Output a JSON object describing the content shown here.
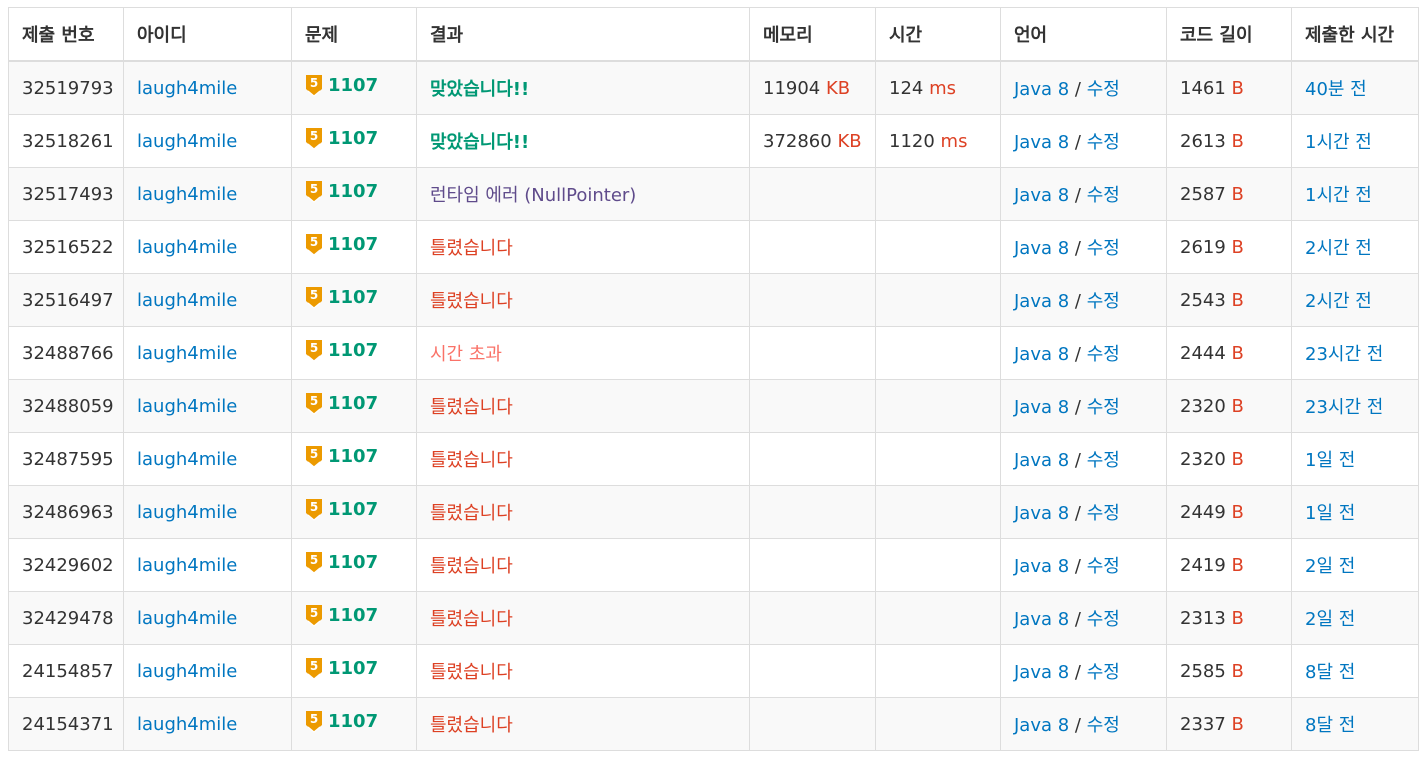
{
  "headers": [
    "제출 번호",
    "아이디",
    "문제",
    "결과",
    "메모리",
    "시간",
    "언어",
    "코드 길이",
    "제출한 시간"
  ],
  "colors": {
    "link": "#0076c0",
    "accepted": "#009874",
    "wrong": "#dd4124",
    "runtime_error": "#5f4b8b",
    "time_limit": "#fa7268",
    "tier_gold": "#ec9a00"
  },
  "tier_icon": "gold-5-tier-icon",
  "tier_label": "5",
  "rows": [
    {
      "id": "32519793",
      "user": "laugh4mile",
      "problem": "1107",
      "result": "맞았습니다!!",
      "status": "ac",
      "memory": "11904",
      "memory_unit": "KB",
      "time": "124",
      "time_unit": "ms",
      "lang": "Java 8",
      "sep": " / ",
      "edit": "수정",
      "length": "1461",
      "length_unit": "B",
      "submitted": "40분 전"
    },
    {
      "id": "32518261",
      "user": "laugh4mile",
      "problem": "1107",
      "result": "맞았습니다!!",
      "status": "ac",
      "memory": "372860",
      "memory_unit": "KB",
      "time": "1120",
      "time_unit": "ms",
      "lang": "Java 8",
      "sep": " / ",
      "edit": "수정",
      "length": "2613",
      "length_unit": "B",
      "submitted": "1시간 전"
    },
    {
      "id": "32517493",
      "user": "laugh4mile",
      "problem": "1107",
      "result": "런타임 에러 (NullPointer)",
      "status": "rte",
      "memory": "",
      "memory_unit": "",
      "time": "",
      "time_unit": "",
      "lang": "Java 8",
      "sep": " / ",
      "edit": "수정",
      "length": "2587",
      "length_unit": "B",
      "submitted": "1시간 전"
    },
    {
      "id": "32516522",
      "user": "laugh4mile",
      "problem": "1107",
      "result": "틀렸습니다",
      "status": "wa",
      "memory": "",
      "memory_unit": "",
      "time": "",
      "time_unit": "",
      "lang": "Java 8",
      "sep": " / ",
      "edit": "수정",
      "length": "2619",
      "length_unit": "B",
      "submitted": "2시간 전"
    },
    {
      "id": "32516497",
      "user": "laugh4mile",
      "problem": "1107",
      "result": "틀렸습니다",
      "status": "wa",
      "memory": "",
      "memory_unit": "",
      "time": "",
      "time_unit": "",
      "lang": "Java 8",
      "sep": " / ",
      "edit": "수정",
      "length": "2543",
      "length_unit": "B",
      "submitted": "2시간 전"
    },
    {
      "id": "32488766",
      "user": "laugh4mile",
      "problem": "1107",
      "result": "시간 초과",
      "status": "tle",
      "memory": "",
      "memory_unit": "",
      "time": "",
      "time_unit": "",
      "lang": "Java 8",
      "sep": " / ",
      "edit": "수정",
      "length": "2444",
      "length_unit": "B",
      "submitted": "23시간 전"
    },
    {
      "id": "32488059",
      "user": "laugh4mile",
      "problem": "1107",
      "result": "틀렸습니다",
      "status": "wa",
      "memory": "",
      "memory_unit": "",
      "time": "",
      "time_unit": "",
      "lang": "Java 8",
      "sep": " / ",
      "edit": "수정",
      "length": "2320",
      "length_unit": "B",
      "submitted": "23시간 전"
    },
    {
      "id": "32487595",
      "user": "laugh4mile",
      "problem": "1107",
      "result": "틀렸습니다",
      "status": "wa",
      "memory": "",
      "memory_unit": "",
      "time": "",
      "time_unit": "",
      "lang": "Java 8",
      "sep": " / ",
      "edit": "수정",
      "length": "2320",
      "length_unit": "B",
      "submitted": "1일 전"
    },
    {
      "id": "32486963",
      "user": "laugh4mile",
      "problem": "1107",
      "result": "틀렸습니다",
      "status": "wa",
      "memory": "",
      "memory_unit": "",
      "time": "",
      "time_unit": "",
      "lang": "Java 8",
      "sep": " / ",
      "edit": "수정",
      "length": "2449",
      "length_unit": "B",
      "submitted": "1일 전"
    },
    {
      "id": "32429602",
      "user": "laugh4mile",
      "problem": "1107",
      "result": "틀렸습니다",
      "status": "wa",
      "memory": "",
      "memory_unit": "",
      "time": "",
      "time_unit": "",
      "lang": "Java 8",
      "sep": " / ",
      "edit": "수정",
      "length": "2419",
      "length_unit": "B",
      "submitted": "2일 전"
    },
    {
      "id": "32429478",
      "user": "laugh4mile",
      "problem": "1107",
      "result": "틀렸습니다",
      "status": "wa",
      "memory": "",
      "memory_unit": "",
      "time": "",
      "time_unit": "",
      "lang": "Java 8",
      "sep": " / ",
      "edit": "수정",
      "length": "2313",
      "length_unit": "B",
      "submitted": "2일 전"
    },
    {
      "id": "24154857",
      "user": "laugh4mile",
      "problem": "1107",
      "result": "틀렸습니다",
      "status": "wa",
      "memory": "",
      "memory_unit": "",
      "time": "",
      "time_unit": "",
      "lang": "Java 8",
      "sep": " / ",
      "edit": "수정",
      "length": "2585",
      "length_unit": "B",
      "submitted": "8달 전"
    },
    {
      "id": "24154371",
      "user": "laugh4mile",
      "problem": "1107",
      "result": "틀렸습니다",
      "status": "wa",
      "memory": "",
      "memory_unit": "",
      "time": "",
      "time_unit": "",
      "lang": "Java 8",
      "sep": " / ",
      "edit": "수정",
      "length": "2337",
      "length_unit": "B",
      "submitted": "8달 전"
    }
  ]
}
